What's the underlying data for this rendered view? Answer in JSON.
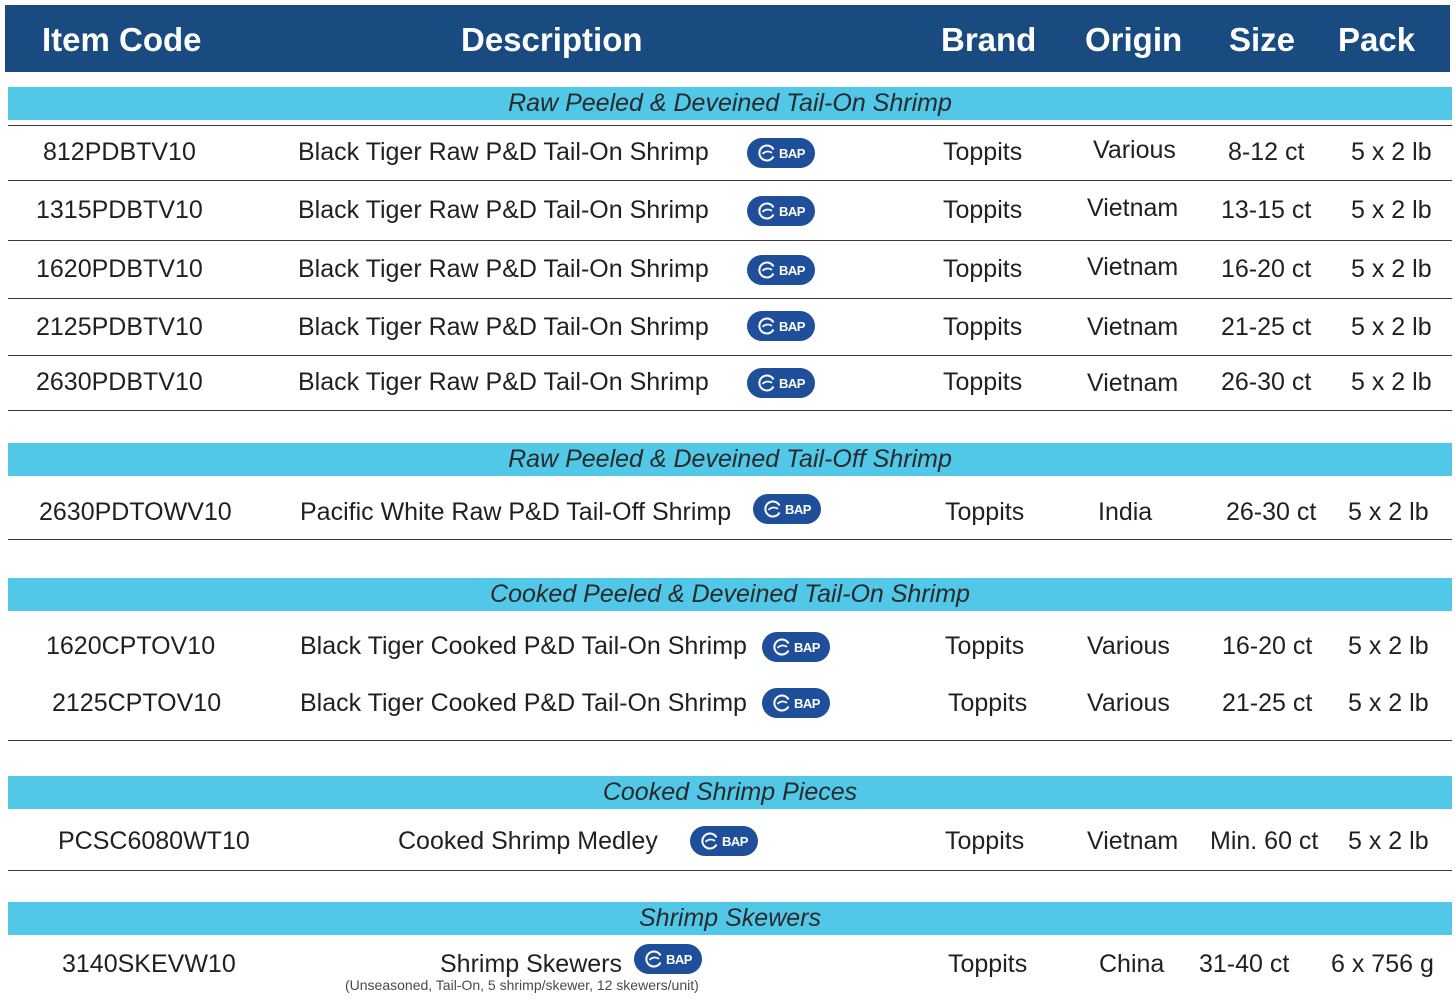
{
  "header": {
    "item_code": "Item Code",
    "description": "Description",
    "brand": "Brand",
    "origin": "Origin",
    "size": "Size",
    "pack": "Pack"
  },
  "sections": [
    {
      "title": "Raw Peeled & Deveined Tail-On Shrimp",
      "rows": [
        {
          "code": "812PDBTV10",
          "description": "Black Tiger Raw P&D Tail-On Shrimp",
          "badge": "BAP",
          "brand": "Toppits",
          "origin": "Various",
          "size": "8-12 ct",
          "pack": "5 x 2 lb"
        },
        {
          "code": "1315PDBTV10",
          "description": "Black Tiger Raw P&D Tail-On Shrimp",
          "badge": "BAP",
          "brand": "Toppits",
          "origin": "Vietnam",
          "size": "13-15 ct",
          "pack": "5 x 2 lb"
        },
        {
          "code": "1620PDBTV10",
          "description": "Black Tiger Raw P&D Tail-On Shrimp",
          "badge": "BAP",
          "brand": "Toppits",
          "origin": "Vietnam",
          "size": "16-20 ct",
          "pack": "5 x 2 lb"
        },
        {
          "code": "2125PDBTV10",
          "description": "Black Tiger Raw P&D Tail-On Shrimp",
          "badge": "BAP",
          "brand": "Toppits",
          "origin": "Vietnam",
          "size": "21-25 ct",
          "pack": "5 x 2 lb"
        },
        {
          "code": "2630PDBTV10",
          "description": "Black Tiger Raw P&D Tail-On Shrimp",
          "badge": "BAP",
          "brand": "Toppits",
          "origin": "Vietnam",
          "size": "26-30 ct",
          "pack": "5 x 2 lb"
        }
      ]
    },
    {
      "title": "Raw Peeled & Deveined Tail-Off Shrimp",
      "rows": [
        {
          "code": "2630PDTOWV10",
          "description": "Pacific White Raw P&D Tail-Off Shrimp",
          "badge": "BAP",
          "brand": "Toppits",
          "origin": "India",
          "size": "26-30 ct",
          "pack": "5 x 2 lb"
        }
      ]
    },
    {
      "title": "Cooked Peeled & Deveined Tail-On Shrimp",
      "rows": [
        {
          "code": "1620CPTOV10",
          "description": "Black Tiger Cooked P&D Tail-On Shrimp",
          "badge": "BAP",
          "brand": "Toppits",
          "origin": "Various",
          "size": "16-20 ct",
          "pack": "5 x 2 lb"
        },
        {
          "code": "2125CPTOV10",
          "description": "Black Tiger Cooked P&D Tail-On Shrimp",
          "badge": "BAP",
          "brand": "Toppits",
          "origin": "Various",
          "size": "21-25 ct",
          "pack": "5 x 2 lb"
        }
      ]
    },
    {
      "title": "Cooked Shrimp Pieces",
      "rows": [
        {
          "code": "PCSC6080WT10",
          "description": "Cooked Shrimp Medley",
          "badge": "BAP",
          "brand": "Toppits",
          "origin": "Vietnam",
          "size": "Min. 60 ct",
          "pack": "5 x 2 lb"
        }
      ]
    },
    {
      "title": "Shrimp Skewers",
      "rows": [
        {
          "code": "3140SKEVW10",
          "description": "Shrimp Skewers",
          "note": "(Unseasoned, Tail-On, 5 shrimp/skewer, 12 skewers/unit)",
          "badge": "BAP",
          "brand": "Toppits",
          "origin": "China",
          "size": "31-40 ct",
          "pack": "6 x 756 g"
        }
      ]
    }
  ],
  "colors": {
    "header_bg": "#1a4b80",
    "section_bg": "#52c8e9",
    "badge_bg": "#1f4f9a"
  },
  "badge_icon": "bap-certified-logo"
}
